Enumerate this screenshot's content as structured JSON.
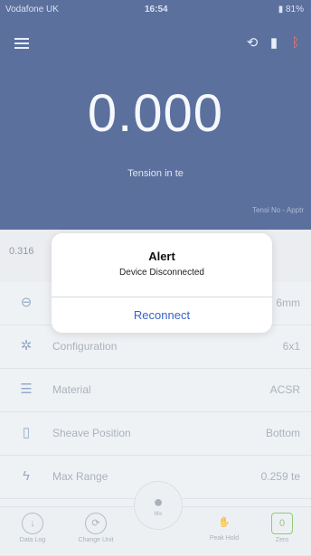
{
  "status_bar": {
    "carrier": "Vodafone UK",
    "time": "16:54",
    "battery": "81%"
  },
  "header": {
    "reading": "0.000",
    "unit_label": "Tension in te",
    "footer_text": "Tensi No - Apptr"
  },
  "sub_value": "0.316",
  "list": [
    {
      "icon": "tension-dial-icon",
      "label": "",
      "value": "6mm"
    },
    {
      "icon": "configuration-icon",
      "label": "Configuration",
      "value": "6x1"
    },
    {
      "icon": "material-icon",
      "label": "Material",
      "value": "ACSR"
    },
    {
      "icon": "sheave-position-icon",
      "label": "Sheave Position",
      "value": "Bottom"
    },
    {
      "icon": "max-range-icon",
      "label": "Max Range",
      "value": "0.259 te"
    }
  ],
  "bottom_tabs": [
    {
      "label": "Data Log",
      "icon": "download-icon"
    },
    {
      "label": "Change Unit",
      "icon": "change-unit-icon"
    },
    {
      "label": "Peak Hold",
      "icon": "hand-icon"
    },
    {
      "label": "Zero",
      "icon": "zero-icon"
    }
  ],
  "mic_label": "Mic",
  "alert": {
    "title": "Alert",
    "message": "Device Disconnected",
    "button": "Reconnect"
  }
}
